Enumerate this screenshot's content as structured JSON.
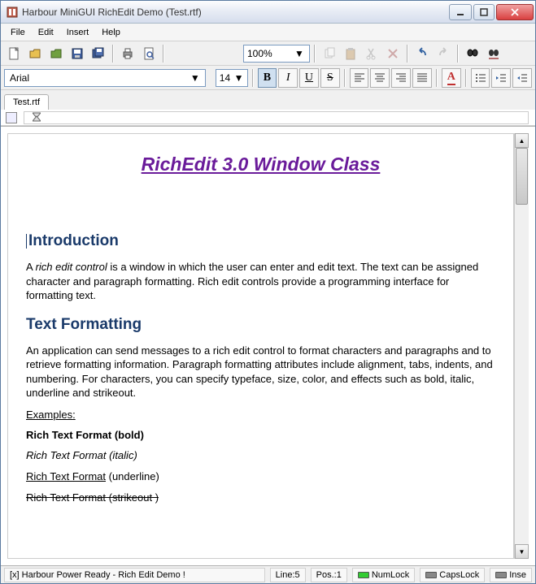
{
  "window": {
    "title": "Harbour MiniGUI RichEdit Demo (Test.rtf)"
  },
  "menu": {
    "file": "File",
    "edit": "Edit",
    "insert": "Insert",
    "help": "Help"
  },
  "toolbar": {
    "zoom": "100%",
    "font": "Arial",
    "size": "14"
  },
  "tabs": {
    "tab1": "Test.rtf"
  },
  "document": {
    "title": "RichEdit 3.0 Window Class",
    "h_intro": "Introduction",
    "p_intro_a": "A ",
    "p_intro_em": "rich edit control",
    "p_intro_b": " is a window in which the user can enter and edit text. The text can be assigned character and paragraph formatting. Rich edit controls provide a programming interface for formatting text.",
    "h_fmt": "Text Formatting",
    "p_fmt": "An application can send messages to a rich edit control to format characters and paragraphs and to retrieve formatting information. Paragraph formatting attributes include alignment, tabs, indents, and numbering. For characters, you can specify typeface, size, color, and effects such as bold, italic, underline and strikeout.",
    "examples_label": "Examples",
    "ex_bold": "Rich Text Format (bold)",
    "ex_italic": "Rich Text Format (italic)",
    "ex_under_a": "Rich Text Format",
    "ex_under_b": " (underline)",
    "ex_strike": "Rich Text Format (strikeout )"
  },
  "status": {
    "main": "[x] Harbour Power Ready - Rich Edit Demo !",
    "line": "Line:5",
    "pos": "Pos.:1",
    "numlock": "NumLock",
    "capslock": "CapsLock",
    "insert": "Inse"
  },
  "icons": {
    "new": "new",
    "open": "open",
    "opendb": "opendb",
    "save": "save",
    "saveall": "saveall",
    "print": "print",
    "preview": "preview",
    "copy": "copy",
    "paste": "paste",
    "cut": "cut",
    "delete": "delete",
    "undo": "undo",
    "redo": "redo",
    "find": "find",
    "replace": "replace",
    "bold": "B",
    "italic": "I",
    "underline": "U",
    "strike": "S",
    "left": "left",
    "center": "center",
    "right": "right",
    "justify": "justify",
    "fontcolor": "A",
    "bullets": "bullets",
    "indent_less": "indent-less",
    "indent_more": "indent-more"
  }
}
